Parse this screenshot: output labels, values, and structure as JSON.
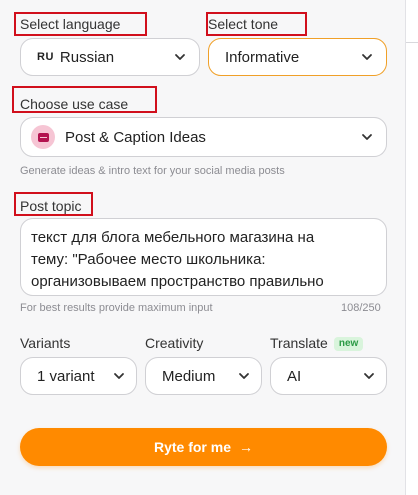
{
  "language": {
    "label": "Select language",
    "code": "RU",
    "value": "Russian"
  },
  "tone": {
    "label": "Select tone",
    "value": "Informative"
  },
  "use_case": {
    "label": "Choose use case",
    "value": "Post & Caption Ideas",
    "hint": "Generate ideas & intro text for your social media posts",
    "icon": "post-card-icon"
  },
  "post_topic": {
    "label": "Post topic",
    "lines": [
      "текст для блога мебельного магазина на",
      "тему: \"Рабочее место школьника:",
      "организовываем пространство правильно"
    ],
    "hint": "For best results provide maximum input",
    "counter": "108/250"
  },
  "variants": {
    "label": "Variants",
    "value": "1 variant"
  },
  "creativity": {
    "label": "Creativity",
    "value": "Medium"
  },
  "translate": {
    "label": "Translate",
    "badge": "new",
    "value": "AI"
  },
  "cta": {
    "label": "Ryte for me",
    "arrow": "→"
  },
  "colors": {
    "accent": "#ff8a00",
    "highlight": "#d10f1c",
    "badge_bg": "#d9f4dc",
    "badge_text": "#2b9a45"
  }
}
